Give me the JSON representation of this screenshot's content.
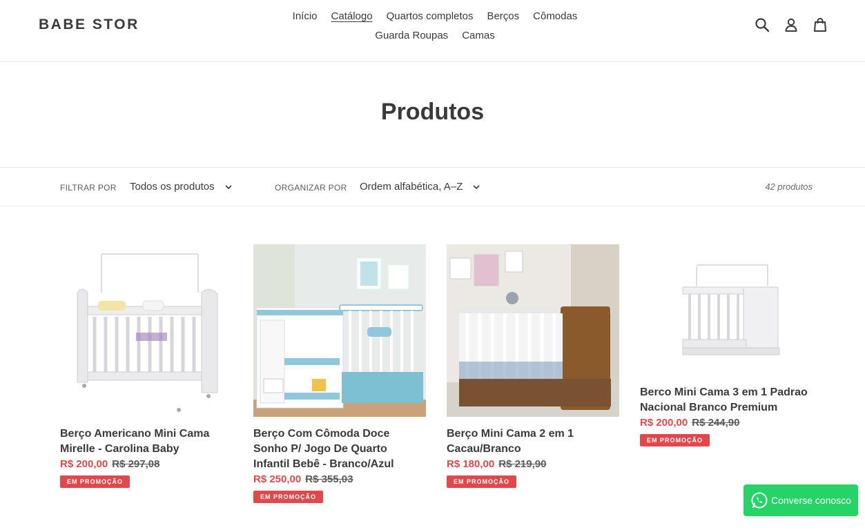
{
  "header": {
    "logo": "BABE STOR",
    "nav": [
      "Início",
      "Catálogo",
      "Quartos completos",
      "Berços",
      "Cômodas",
      "Guarda Roupas",
      "Camas"
    ],
    "icons": [
      "search-icon",
      "user-icon",
      "cart-icon"
    ]
  },
  "page": {
    "title": "Produtos"
  },
  "filters": {
    "filter_label": "FILTRAR POR",
    "filter_value": "Todos os produtos",
    "sort_label": "ORGANIZAR POR",
    "sort_value": "Ordem alfabética, A–Z",
    "count": "42 produtos"
  },
  "products": [
    {
      "title": "Berço Americano Mini Cama Mirelle - Carolina Baby",
      "price": "R$ 200,00",
      "old_price": "R$ 297,08",
      "badge": "EM PROMOÇÃO"
    },
    {
      "title": "Berço Com Cômoda Doce Sonho P/ Jogo De Quarto Infantil Bebê - Branco/Azul",
      "price": "R$ 250,00",
      "old_price": "R$ 355,03",
      "badge": "EM PROMOÇÃO"
    },
    {
      "title": "Berço Mini Cama 2 em 1 Cacau/Branco",
      "price": "R$ 180,00",
      "old_price": "R$ 219,90",
      "badge": "EM PROMOÇÃO"
    },
    {
      "title": "Berco Mini Cama 3 em 1 Padrao Nacional Branco Premium",
      "price": "R$ 200,00",
      "old_price": "R$ 244,90",
      "badge": "EM PROMOÇÃO"
    }
  ],
  "whatsapp": {
    "label": "Converse conosco"
  },
  "colors": {
    "sale": "#e2474b",
    "whatsapp": "#25d366",
    "text": "#3a3a3a"
  }
}
